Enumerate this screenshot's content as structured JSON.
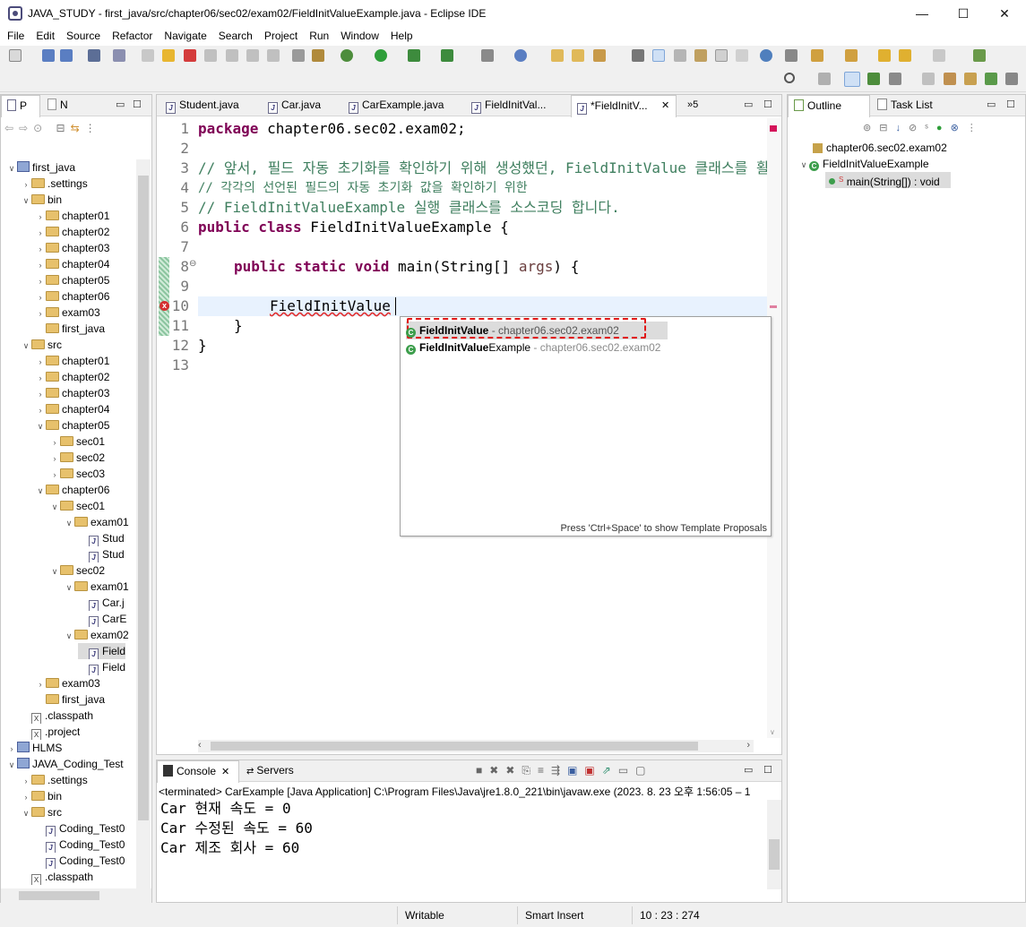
{
  "window": {
    "title": "JAVA_STUDY - first_java/src/chapter06/sec02/exam02/FieldInitValueExample.java - Eclipse IDE",
    "minimize": "—",
    "maximize": "☐",
    "close": "✕"
  },
  "menu": [
    "File",
    "Edit",
    "Source",
    "Refactor",
    "Navigate",
    "Search",
    "Project",
    "Run",
    "Window",
    "Help"
  ],
  "left_view": {
    "tab1": "P",
    "tab2": "N",
    "tree": [
      {
        "label": "first_java",
        "depth": 0,
        "kind": "project",
        "open": true
      },
      {
        "label": ".settings",
        "depth": 1,
        "kind": "folder",
        "open": false
      },
      {
        "label": "bin",
        "depth": 1,
        "kind": "folder",
        "open": true
      },
      {
        "label": "chapter01",
        "depth": 2,
        "kind": "folder",
        "open": false
      },
      {
        "label": "chapter02",
        "depth": 2,
        "kind": "folder",
        "open": false
      },
      {
        "label": "chapter03",
        "depth": 2,
        "kind": "folder",
        "open": false
      },
      {
        "label": "chapter04",
        "depth": 2,
        "kind": "folder",
        "open": false
      },
      {
        "label": "chapter05",
        "depth": 2,
        "kind": "folder",
        "open": false
      },
      {
        "label": "chapter06",
        "depth": 2,
        "kind": "folder",
        "open": false
      },
      {
        "label": "exam03",
        "depth": 2,
        "kind": "folder",
        "open": false
      },
      {
        "label": "first_java",
        "depth": 2,
        "kind": "folder",
        "open": null
      },
      {
        "label": "src",
        "depth": 1,
        "kind": "folder",
        "open": true
      },
      {
        "label": "chapter01",
        "depth": 2,
        "kind": "folder",
        "open": false
      },
      {
        "label": "chapter02",
        "depth": 2,
        "kind": "folder",
        "open": false
      },
      {
        "label": "chapter03",
        "depth": 2,
        "kind": "folder",
        "open": false
      },
      {
        "label": "chapter04",
        "depth": 2,
        "kind": "folder",
        "open": false
      },
      {
        "label": "chapter05",
        "depth": 2,
        "kind": "folder",
        "open": true
      },
      {
        "label": "sec01",
        "depth": 3,
        "kind": "folder",
        "open": false
      },
      {
        "label": "sec02",
        "depth": 3,
        "kind": "folder",
        "open": false
      },
      {
        "label": "sec03",
        "depth": 3,
        "kind": "folder",
        "open": false
      },
      {
        "label": "chapter06",
        "depth": 2,
        "kind": "folder",
        "open": true
      },
      {
        "label": "sec01",
        "depth": 3,
        "kind": "folder",
        "open": true
      },
      {
        "label": "exam01",
        "depth": 4,
        "kind": "folder",
        "open": true
      },
      {
        "label": "Stud",
        "depth": 5,
        "kind": "java",
        "open": null
      },
      {
        "label": "Stud",
        "depth": 5,
        "kind": "java",
        "open": null
      },
      {
        "label": "sec02",
        "depth": 3,
        "kind": "folder",
        "open": true
      },
      {
        "label": "exam01",
        "depth": 4,
        "kind": "folder",
        "open": true
      },
      {
        "label": "Car.j",
        "depth": 5,
        "kind": "java",
        "open": null
      },
      {
        "label": "CarE",
        "depth": 5,
        "kind": "java",
        "open": null
      },
      {
        "label": "exam02",
        "depth": 4,
        "kind": "folder",
        "open": true
      },
      {
        "label": "Field",
        "depth": 5,
        "kind": "java",
        "open": null,
        "selected": true
      },
      {
        "label": "Field",
        "depth": 5,
        "kind": "java",
        "open": null
      },
      {
        "label": "exam03",
        "depth": 2,
        "kind": "folder",
        "open": false
      },
      {
        "label": "first_java",
        "depth": 2,
        "kind": "folder",
        "open": null
      },
      {
        "label": ".classpath",
        "depth": 1,
        "kind": "xfile",
        "open": null
      },
      {
        "label": ".project",
        "depth": 1,
        "kind": "xfile",
        "open": null
      },
      {
        "label": "HLMS",
        "depth": 0,
        "kind": "project",
        "open": false
      },
      {
        "label": "JAVA_Coding_Test",
        "depth": 0,
        "kind": "project",
        "open": true
      },
      {
        "label": ".settings",
        "depth": 1,
        "kind": "folder",
        "open": false
      },
      {
        "label": "bin",
        "depth": 1,
        "kind": "folder",
        "open": false
      },
      {
        "label": "src",
        "depth": 1,
        "kind": "folder",
        "open": true
      },
      {
        "label": "Coding_Test0",
        "depth": 2,
        "kind": "java",
        "open": null
      },
      {
        "label": "Coding_Test0",
        "depth": 2,
        "kind": "java",
        "open": null
      },
      {
        "label": "Coding_Test0",
        "depth": 2,
        "kind": "java",
        "open": null
      },
      {
        "label": ".classpath",
        "depth": 1,
        "kind": "xfile",
        "open": null
      }
    ]
  },
  "editor": {
    "tabs": [
      "Student.java",
      "Car.java",
      "CarExample.java",
      "FieldInitVal...",
      "*FieldInitV..."
    ],
    "overflow": "»5",
    "close": "✕",
    "line_numbers": [
      "1",
      "2",
      "3",
      "4",
      "5",
      "6",
      "7",
      "8",
      "9",
      "10",
      "11",
      "12",
      "13"
    ],
    "lines": {
      "l1a": "package",
      "l1b": " chapter06.sec02.exam02;",
      "l3": "// 앞서, 필드 자동 초기화를 확인하기 위해 생성했던, FieldInitValue 클래스를 활",
      "l4": "// 각각의 선언된 필드의 자동 초기화 값을 확인하기 위한",
      "l5": "// FieldInitValueExample 실행 클래스를 소스코딩 합니다.",
      "l6a": "public class",
      "l6b": " FieldInitValueExample {",
      "l8a": "public static void",
      "l8b": " main(String[] ",
      "l8c": "args",
      "l8d": ") {",
      "l10": "FieldInitValue",
      "l11": "}",
      "l12": "}"
    }
  },
  "autocomplete": {
    "items": [
      {
        "bold": "FieldInitValue",
        "rest": "",
        "pkg": " - chapter06.sec02.exam02"
      },
      {
        "bold": "FieldInitValue",
        "rest": "Example",
        "pkg": " - chapter06.sec02.exam02"
      }
    ],
    "hint": "Press 'Ctrl+Space' to show Template Proposals"
  },
  "outline": {
    "tab1": "Outline",
    "tab2": "Task List",
    "package": "chapter06.sec02.exam02",
    "class": "FieldInitValueExample",
    "method": "main(String[]) : void"
  },
  "console": {
    "tab1": "Console",
    "tab2": "Servers",
    "header": "<terminated> CarExample [Java Application] C:\\Program Files\\Java\\jre1.8.0_221\\bin\\javaw.exe  (2023. 8. 23 오후 1:56:05 – 1",
    "lines": [
      "Car 현재 속도 = 0",
      "Car 수정된 속도 = 60",
      "Car 제조 회사 = 60"
    ]
  },
  "status": {
    "writable": "Writable",
    "insert": "Smart Insert",
    "position": "10 : 23 : 274"
  }
}
